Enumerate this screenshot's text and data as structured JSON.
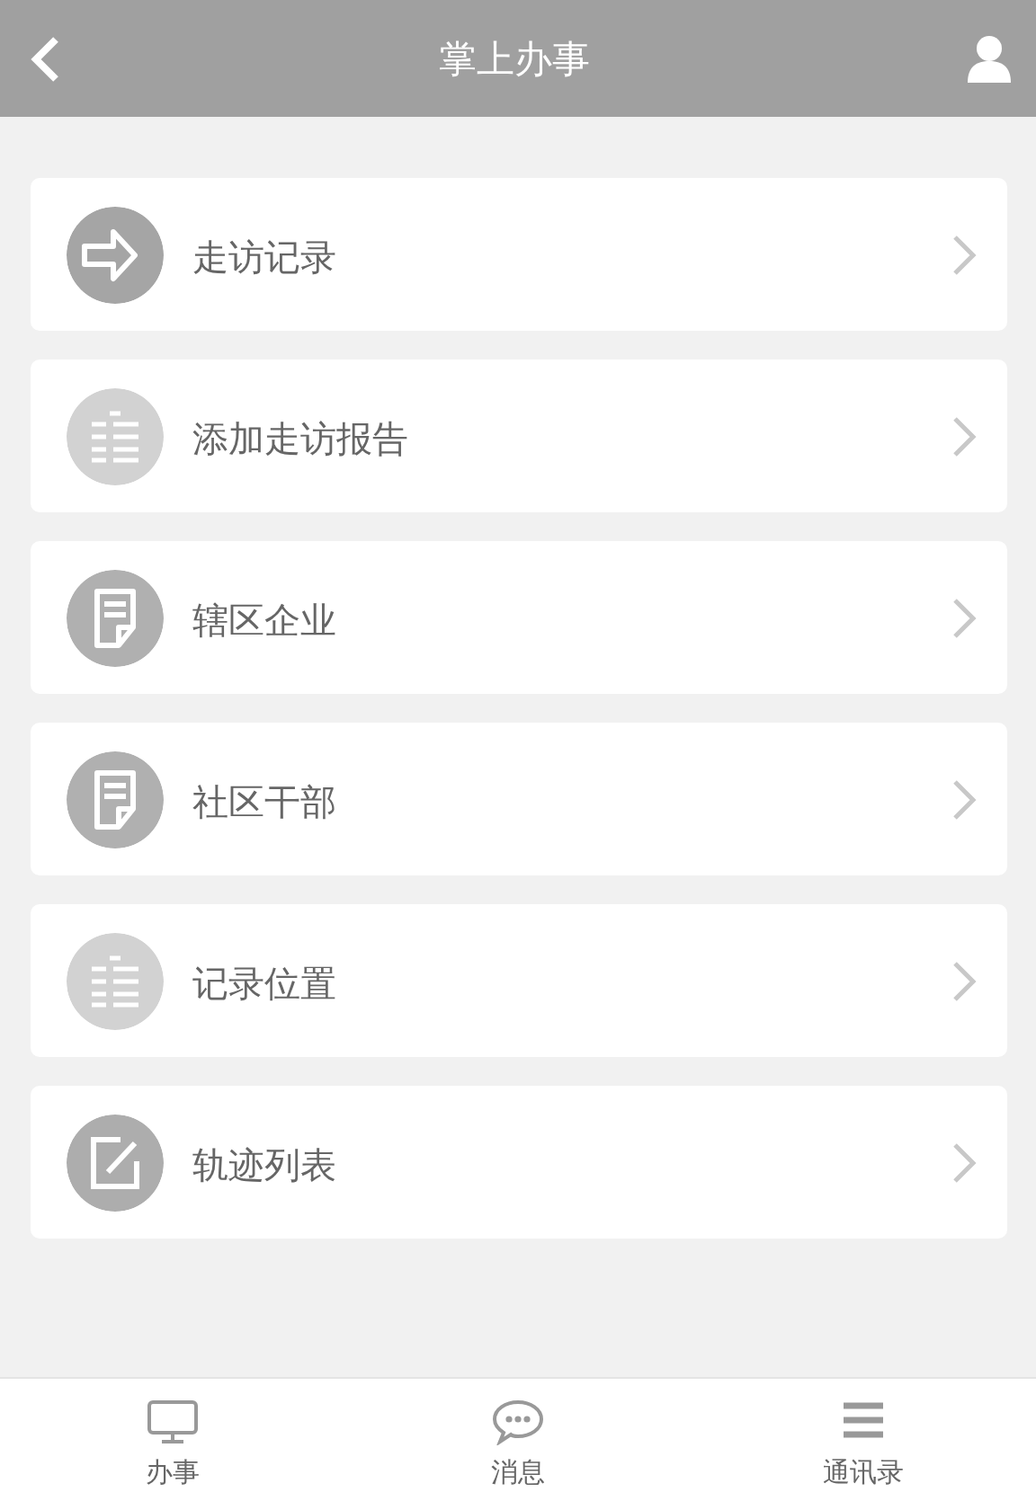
{
  "header": {
    "title": "掌上办事"
  },
  "menu": [
    {
      "label": "走访记录",
      "kind": "arrow"
    },
    {
      "label": "添加走访报告",
      "kind": "list"
    },
    {
      "label": "辖区企业",
      "kind": "document"
    },
    {
      "label": "社区干部",
      "kind": "document"
    },
    {
      "label": "记录位置",
      "kind": "list"
    },
    {
      "label": "轨迹列表",
      "kind": "edit"
    }
  ],
  "tab_bar": [
    {
      "label": "办事",
      "kind": "monitor"
    },
    {
      "label": "消息",
      "kind": "chat"
    },
    {
      "label": "通讯录",
      "kind": "menu"
    }
  ]
}
